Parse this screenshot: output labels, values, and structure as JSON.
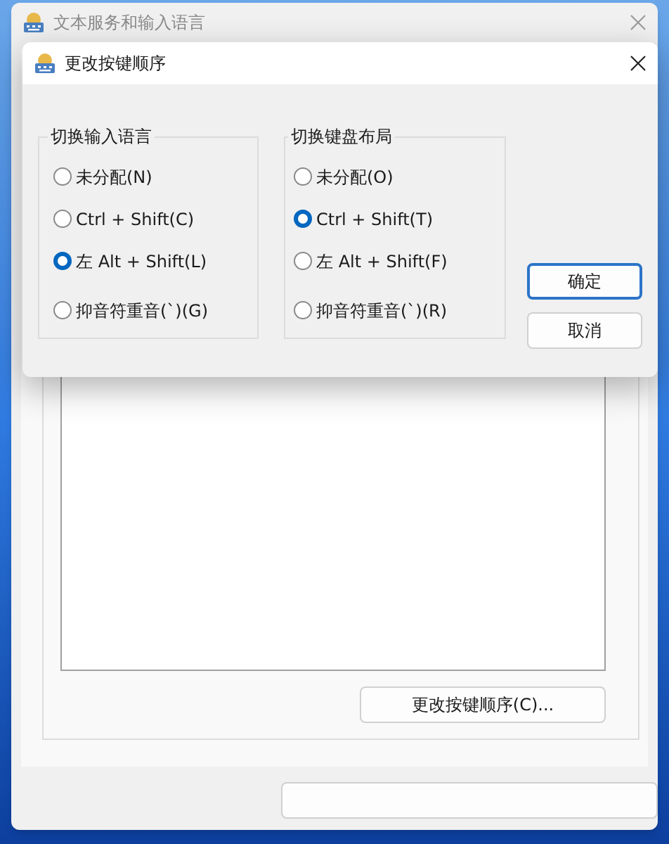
{
  "back_window": {
    "title": "文本服务和输入语言",
    "button": "更改按键顺序(C)..."
  },
  "dialog": {
    "title": "更改按键顺序",
    "groups": [
      {
        "title": "切换输入语言",
        "options": [
          {
            "label": "未分配(N)",
            "selected": false
          },
          {
            "label": "Ctrl + Shift(C)",
            "selected": false
          },
          {
            "label": "左 Alt + Shift(L)",
            "selected": true
          },
          {
            "label": "抑音符重音(`)(G)",
            "selected": false
          }
        ]
      },
      {
        "title": "切换键盘布局",
        "options": [
          {
            "label": "未分配(O)",
            "selected": false
          },
          {
            "label": "Ctrl + Shift(T)",
            "selected": true
          },
          {
            "label": "左 Alt + Shift(F)",
            "selected": false
          },
          {
            "label": "抑音符重音(`)(R)",
            "selected": false
          }
        ]
      }
    ],
    "buttons": [
      {
        "label": "确定",
        "default": true
      },
      {
        "label": "取消",
        "default": false
      }
    ]
  }
}
